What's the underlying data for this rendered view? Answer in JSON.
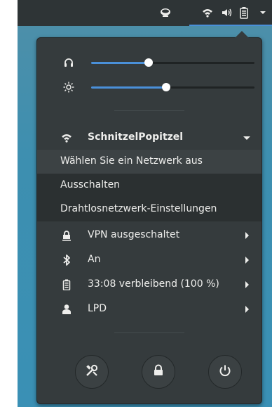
{
  "topbar": {
    "icons": [
      "coffee-cup-icon",
      "wifi-icon",
      "volume-icon",
      "battery-icon",
      "chevron-down-icon"
    ]
  },
  "sliders": [
    {
      "name": "headphones-volume",
      "icon": "headphones-icon",
      "level": 0.35
    },
    {
      "name": "brightness",
      "icon": "brightness-icon",
      "level": 0.46
    }
  ],
  "wifi": {
    "network_name": "SchnitzelPopitzel",
    "submenu": [
      "Wählen Sie ein Netzwerk aus",
      "Ausschalten",
      "Drahtlosnetzwerk-Einstellungen"
    ]
  },
  "items": {
    "vpn": "VPN ausgeschaltet",
    "bluetooth": "An",
    "battery": "33:08 verbleibend (100 %)",
    "user": "LPD"
  },
  "actions": [
    "settings-icon",
    "lock-icon",
    "power-icon"
  ],
  "colors": {
    "accent": "#4a90d9",
    "menu_bg": "#353b3d",
    "topbar": "#2e3436"
  }
}
